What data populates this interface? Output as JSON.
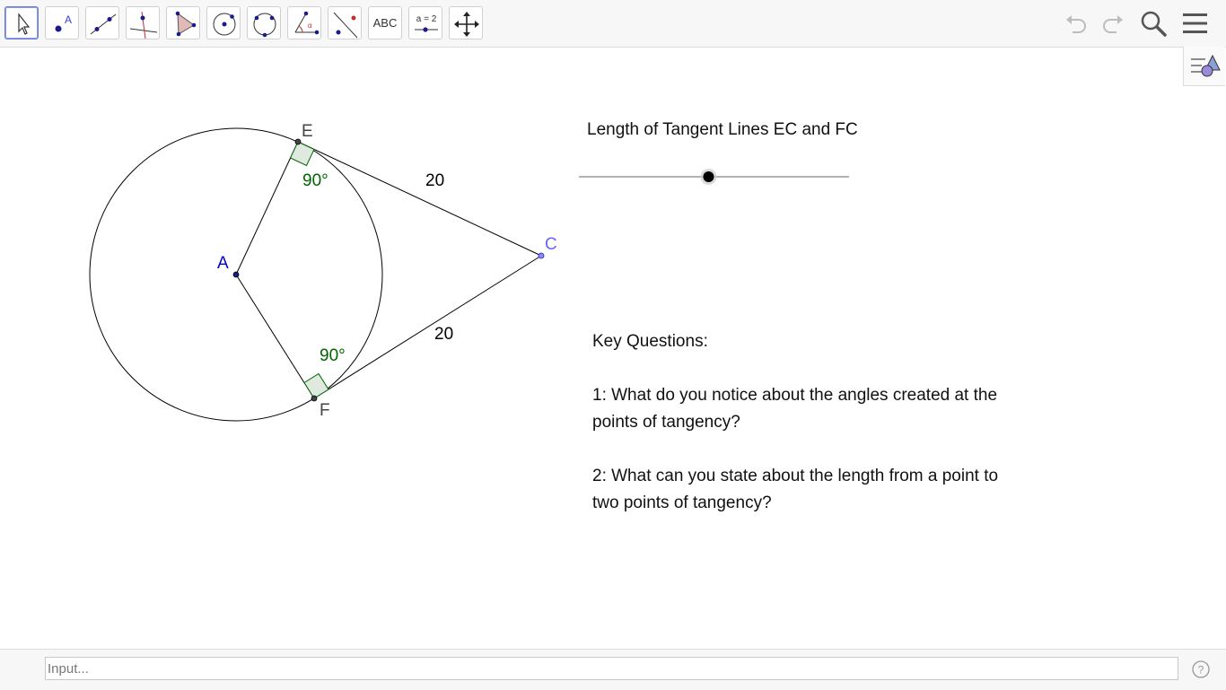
{
  "toolbar": {
    "tools": [
      {
        "name": "move-tool",
        "icon": "arrow-cursor-icon"
      },
      {
        "name": "point-tool",
        "icon": "point-icon",
        "label": "A"
      },
      {
        "name": "line-tool",
        "icon": "line-icon"
      },
      {
        "name": "perpendicular-line-tool",
        "icon": "perpendicular-icon"
      },
      {
        "name": "polygon-tool",
        "icon": "polygon-icon"
      },
      {
        "name": "circle-center-point-tool",
        "icon": "circle-icon"
      },
      {
        "name": "circle-three-points-tool",
        "icon": "circle-three-points-icon"
      },
      {
        "name": "angle-tool",
        "icon": "angle-icon"
      },
      {
        "name": "reflect-tool",
        "icon": "reflect-icon"
      },
      {
        "name": "text-tool",
        "icon": "text-icon",
        "label": "ABC"
      },
      {
        "name": "slider-tool",
        "icon": "slider-icon",
        "label": "a = 2"
      },
      {
        "name": "move-graphics-view-tool",
        "icon": "move-view-icon"
      }
    ],
    "right": [
      "undo-icon",
      "redo-icon",
      "search-icon",
      "menu-icon"
    ]
  },
  "graphics": {
    "points": {
      "A": "A",
      "E": "E",
      "F": "F",
      "C": "C"
    },
    "angle_labels": {
      "E": "90°",
      "F": "90°"
    },
    "segment_labels": {
      "EC": "20",
      "FC": "20"
    },
    "colors": {
      "point_label": "#0000cc",
      "angle": "#006400",
      "c_label": "#6666ff"
    }
  },
  "slider": {
    "title": "Length of Tangent Lines EC and FC",
    "value_fraction": 0.48
  },
  "questions": {
    "heading": "Key Questions:",
    "q1": "1: What do you notice about the angles created at the points of tangency?",
    "q2": "2: What can you state about the length from a point to two points of tangency?"
  },
  "input_bar": {
    "placeholder": "Input...",
    "help_icon": "help-icon"
  }
}
